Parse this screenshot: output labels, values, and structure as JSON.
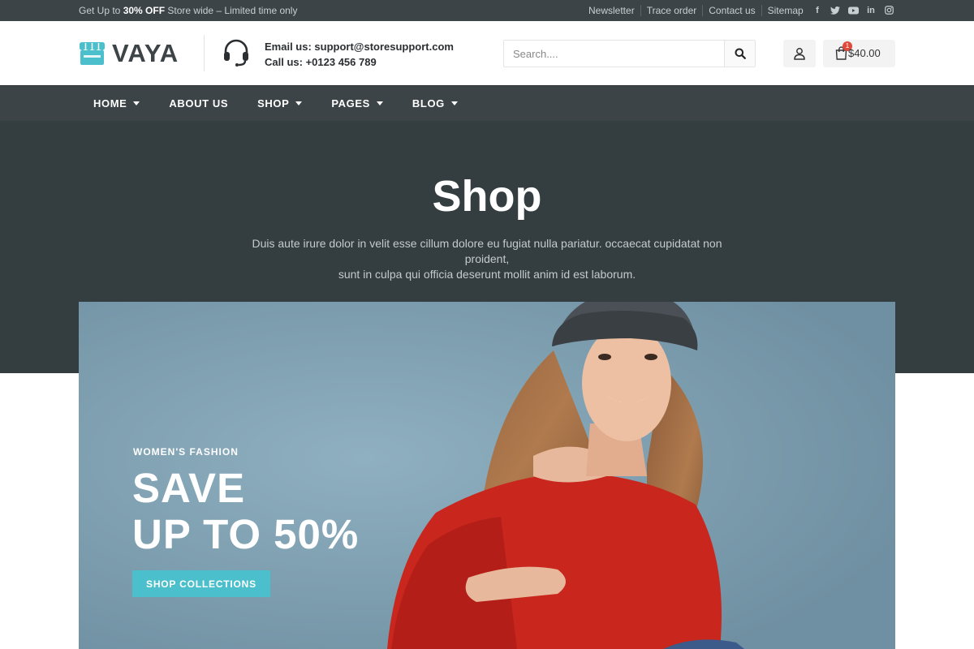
{
  "topbar": {
    "promo_prefix": "Get Up to ",
    "promo_bold": "30% OFF",
    "promo_suffix": " Store wide – Limited time only",
    "links": [
      "Newsletter",
      "Trace order",
      "Contact us",
      "Sitemap"
    ],
    "social_icons": [
      "facebook-icon",
      "twitter-icon",
      "youtube-icon",
      "linkedin-icon",
      "instagram-icon"
    ]
  },
  "header": {
    "logo_text": "VAYA",
    "email_line": "Email us: support@storesupport.com",
    "phone_line": "Call us: +0123 456 789",
    "search_placeholder": "Search....",
    "cart_count": "1",
    "cart_total": "$40.00"
  },
  "nav": {
    "items": [
      {
        "label": "HOME",
        "dropdown": true
      },
      {
        "label": "ABOUT US",
        "dropdown": false
      },
      {
        "label": "SHOP",
        "dropdown": true
      },
      {
        "label": "PAGES",
        "dropdown": true
      },
      {
        "label": "BLOG",
        "dropdown": true
      }
    ]
  },
  "hero": {
    "title": "Shop",
    "subtitle_line1": "Duis aute irure dolor in velit esse cillum dolore eu fugiat nulla pariatur. occaecat cupidatat non proident,",
    "subtitle_line2": "sunt in culpa qui officia deserunt mollit anim id est laborum."
  },
  "banner": {
    "eyebrow": "WOMEN'S FASHION",
    "headline_line1": "SAVE",
    "headline_line2": "UP TO 50%",
    "cta_label": "SHOP COLLECTIONS"
  },
  "colors": {
    "dark": "#3d4447",
    "hero_bg": "#343d3f",
    "accent": "#4bbfcb",
    "badge": "#e04a3c"
  }
}
